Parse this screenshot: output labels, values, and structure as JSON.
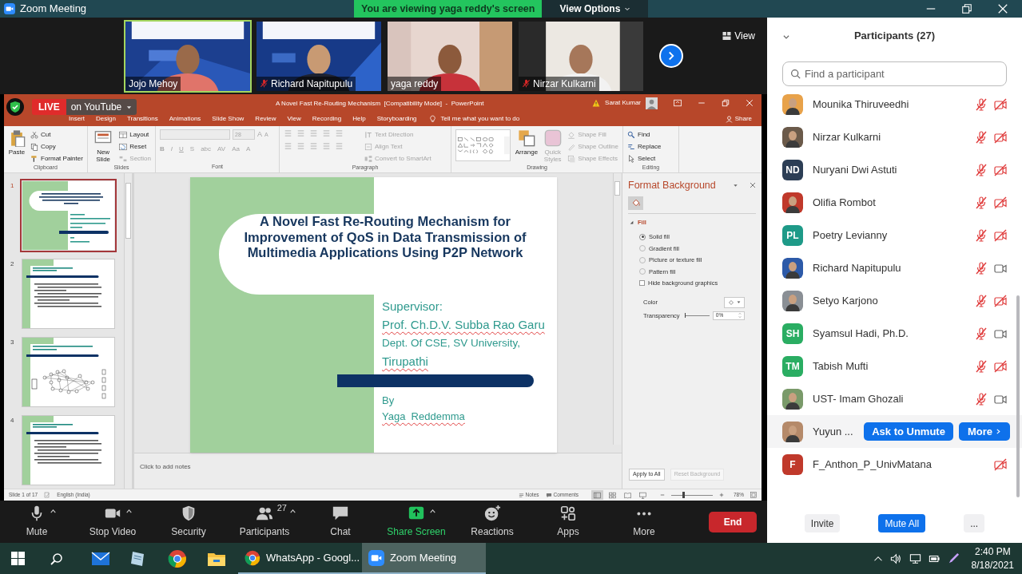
{
  "window": {
    "title": "Zoom Meeting"
  },
  "share_banner": {
    "text": "You are viewing yaga reddy's screen",
    "options": "View Options"
  },
  "video_tiles": [
    {
      "name": "Jojo Mehoy",
      "muted": false,
      "speaking": true
    },
    {
      "name": "Richard Napitupulu",
      "muted": true,
      "speaking": false
    },
    {
      "name": "yaga reddy",
      "muted": false,
      "speaking": false
    },
    {
      "name": "Nirzar Kulkarni",
      "muted": true,
      "speaking": false
    }
  ],
  "view_button": "View",
  "live_badge": {
    "live": "LIVE",
    "label": "on YouTube"
  },
  "powerpoint": {
    "title": "A Novel Fast Re-Routing Mechanism  [Compatibility Mode]  -  PowerPoint",
    "user": "Sarat Kumar",
    "tabs": [
      {
        "label": "Insert",
        "selected": false
      },
      {
        "label": "Design",
        "selected": false
      },
      {
        "label": "Transitions",
        "selected": false
      },
      {
        "label": "Animations",
        "selected": false
      },
      {
        "label": "Slide Show",
        "selected": false
      },
      {
        "label": "Review",
        "selected": false
      },
      {
        "label": "View",
        "selected": false
      },
      {
        "label": "Recording",
        "selected": false
      },
      {
        "label": "Help",
        "selected": false
      },
      {
        "label": "Storyboarding",
        "selected": false
      }
    ],
    "tell_me": "Tell me what you want to do",
    "share": "Share",
    "ribbon": [
      {
        "kind": "clipboard",
        "label": "Clipboard",
        "items": [
          {
            "label": "Paste",
            "disabled": false
          },
          {
            "label": "Cut",
            "disabled": false
          },
          {
            "label": "Copy",
            "disabled": false
          },
          {
            "label": "Format Painter",
            "disabled": false
          }
        ]
      },
      {
        "kind": "slides",
        "label": "Slides",
        "items": [
          {
            "label": "New Slide",
            "disabled": false
          },
          {
            "label": "Layout",
            "disabled": false
          },
          {
            "label": "Reset",
            "disabled": false
          },
          {
            "label": "Section",
            "disabled": true
          }
        ]
      },
      {
        "kind": "font",
        "label": "Font",
        "disabled": true,
        "size": "28",
        "sizing": [
          "A",
          "A"
        ],
        "items": [
          {
            "label": "B"
          },
          {
            "label": "I"
          },
          {
            "label": "U"
          },
          {
            "label": "S"
          },
          {
            "label": "abc"
          },
          {
            "label": "AV"
          },
          {
            "label": "Aa"
          },
          {
            "label": "A"
          }
        ]
      },
      {
        "kind": "paragraph",
        "label": "Paragraph",
        "disabled": true,
        "items": [
          {
            "label": "Text Direction"
          },
          {
            "label": "Align Text"
          },
          {
            "label": "Convert to SmartArt"
          }
        ]
      },
      {
        "kind": "drawing",
        "label": "Drawing",
        "items": [
          {
            "label": "Arrange",
            "disabled": false
          },
          {
            "label": "Quick Styles",
            "disabled": true
          },
          {
            "label": "Shape Fill",
            "disabled": true
          },
          {
            "label": "Shape Outline",
            "disabled": true
          },
          {
            "label": "Shape Effects",
            "disabled": true
          }
        ]
      },
      {
        "kind": "editing",
        "label": "Editing",
        "items": [
          {
            "label": "Find",
            "disabled": false
          },
          {
            "label": "Replace",
            "disabled": false
          },
          {
            "label": "Select",
            "disabled": false
          }
        ]
      }
    ],
    "thumbnails": [
      {
        "number": "1",
        "selected": true,
        "kind": "title"
      },
      {
        "number": "2",
        "selected": false,
        "kind": "bullets"
      },
      {
        "number": "3",
        "selected": false,
        "kind": "diagram"
      },
      {
        "number": "4",
        "selected": false,
        "kind": "bullets"
      }
    ],
    "slide": {
      "title": "A Novel Fast Re-Routing Mechanism for Improvement of QoS in Data Transmission of Multimedia Applications Using P2P Network",
      "lines": [
        {
          "text": "Supervisor:",
          "misspelled": false
        },
        {
          "text": "Prof. Ch.D.V. Subba Rao Garu",
          "misspelled": true
        },
        {
          "text": "Dept. Of CSE, SV University,",
          "misspelled": false
        },
        {
          "text": "Tirupathi",
          "misspelled": true
        }
      ],
      "byline": [
        {
          "text": "By",
          "misspelled": false
        },
        {
          "text": "Yaga  Reddemma",
          "misspelled": true
        }
      ]
    },
    "notes_placeholder": "Click to add notes",
    "format_pane": {
      "title": "Format Background",
      "section": "Fill",
      "expanded": true,
      "fill_options": [
        {
          "label": "Solid fill",
          "selected": true
        },
        {
          "label": "Gradient fill",
          "selected": false
        },
        {
          "label": "Picture or texture fill",
          "selected": false
        },
        {
          "label": "Pattern fill",
          "selected": false
        }
      ],
      "hide_graphics": {
        "label": "Hide background graphics",
        "checked": false
      },
      "color_label": "Color",
      "transparency": {
        "label": "Transparency",
        "level": 0,
        "value": "0%"
      },
      "buttons": [
        {
          "label": "Apply to All",
          "disabled": false
        },
        {
          "label": "Reset Background",
          "disabled": true
        }
      ]
    },
    "status_bar": {
      "slide": "Slide 1 of 17",
      "language": "English (India)",
      "notes": "Notes",
      "comments": "Comments",
      "zoom": "78%",
      "zoom_slider": {
        "level": 0.28
      }
    }
  },
  "toolbar": {
    "items": [
      {
        "label": "Mute",
        "caret": true,
        "accent": false
      },
      {
        "label": "Stop Video",
        "caret": true,
        "accent": false
      },
      {
        "label": "Security",
        "caret": false,
        "accent": false
      },
      {
        "label": "Participants",
        "caret": true,
        "accent": false,
        "count": "27"
      },
      {
        "label": "Chat",
        "caret": false,
        "accent": false
      },
      {
        "label": "Share Screen",
        "caret": true,
        "accent": true
      },
      {
        "label": "Reactions",
        "caret": false,
        "accent": false
      },
      {
        "label": "Apps",
        "caret": false,
        "accent": false
      },
      {
        "label": "More",
        "caret": false,
        "accent": false
      }
    ],
    "end": "End"
  },
  "participants": {
    "title": "Participants (27)",
    "search": {
      "placeholder": "Find a participant"
    },
    "list": [
      {
        "name": "Mounika Thiruveedhi",
        "muted": true,
        "video_on": false,
        "hovered": false
      },
      {
        "name": "Nirzar Kulkarni",
        "muted": true,
        "video_on": false,
        "hovered": false
      },
      {
        "name": "Nuryani Dwi Astuti",
        "kind": "initials",
        "initials": "ND",
        "color": "#2c3e55",
        "muted": true,
        "video_on": false,
        "hovered": false
      },
      {
        "name": "Olifia Rombot",
        "muted": true,
        "video_on": false,
        "hovered": false
      },
      {
        "name": "Poetry Levianny",
        "kind": "initials",
        "initials": "PL",
        "color": "#1e9a88",
        "muted": true,
        "video_on": false,
        "hovered": false
      },
      {
        "name": "Richard Napitupulu",
        "muted": true,
        "video_on": true,
        "hovered": false
      },
      {
        "name": "Setyo Karjono",
        "muted": true,
        "video_on": false,
        "hovered": false
      },
      {
        "name": "Syamsul Hadi, Ph.D.",
        "kind": "initials",
        "initials": "SH",
        "color": "#2aad62",
        "muted": true,
        "video_on": true,
        "hovered": false
      },
      {
        "name": "Tabish Mufti",
        "kind": "initials",
        "initials": "TM",
        "color": "#2aad62",
        "muted": true,
        "video_on": false,
        "hovered": false
      },
      {
        "name": "UST- Imam Ghozali",
        "muted": true,
        "video_on": true,
        "hovered": false
      },
      {
        "name": "Yuyun ...",
        "hovered": true,
        "actions": [
          "Ask to Unmute",
          "More"
        ]
      },
      {
        "name": "F_Anthon_P_UnivMatana",
        "kind": "initials",
        "initials": "F",
        "color": "#c0392b",
        "video_on": false,
        "hovered": false
      }
    ],
    "footer": [
      {
        "label": "Invite",
        "primary": false
      },
      {
        "label": "Mute All",
        "primary": true
      },
      {
        "label": "...",
        "primary": false
      }
    ]
  },
  "taskbar": {
    "apps": [
      {
        "label": "WhatsApp - Googl...",
        "active": false
      },
      {
        "label": "Zoom Meeting",
        "active": true
      }
    ],
    "time": "2:40 PM",
    "date": "8/18/2021"
  }
}
